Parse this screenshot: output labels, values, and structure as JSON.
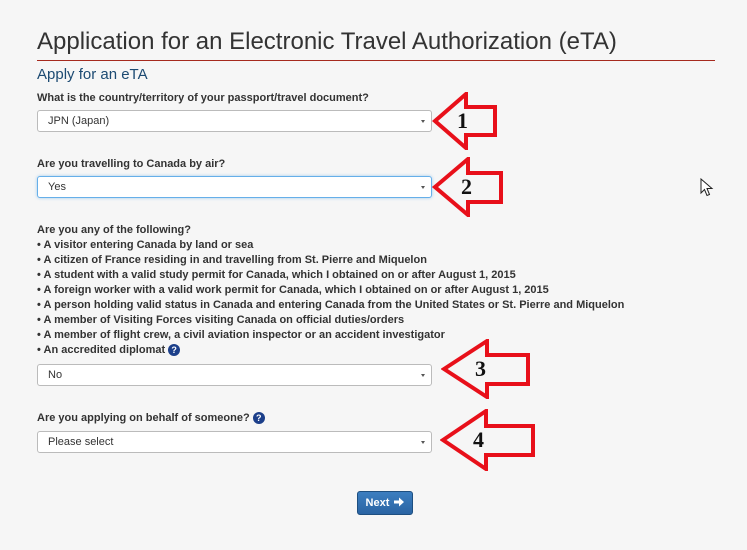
{
  "page": {
    "title": "Application for an Electronic Travel Authorization (eTA)",
    "subtitle": "Apply for an eTA"
  },
  "q1": {
    "label": "What is the country/territory of your passport/travel document?",
    "value": "JPN (Japan)"
  },
  "q2": {
    "label": "Are you travelling to Canada by air?",
    "value": "Yes"
  },
  "q3": {
    "label": "Are you any of the following?",
    "items": [
      "• A visitor entering Canada by land or sea",
      "• A citizen of France residing in and travelling from St. Pierre and Miquelon",
      "• A student with a valid study permit for Canada, which I obtained on or after August 1, 2015",
      "• A foreign worker with a valid work permit for Canada, which I obtained on or after August 1, 2015",
      "• A person holding valid status in Canada and entering Canada from the United States or St. Pierre and Miquelon",
      "• A member of Visiting Forces visiting Canada on official duties/orders",
      "• A member of flight crew, a civil aviation inspector or an accident investigator",
      "• An accredited diplomat"
    ],
    "value": "No"
  },
  "q4": {
    "label": "Are you applying on behalf of someone?",
    "value": "Please select"
  },
  "help_glyph": "?",
  "next_button": {
    "label": "Next"
  },
  "annotations": [
    "1",
    "2",
    "3",
    "4"
  ],
  "colors": {
    "title_rule": "#a62a1e",
    "subtitle": "#1c4a72",
    "annotation_arrow": "#e8101a",
    "button": "#2f6db0"
  }
}
